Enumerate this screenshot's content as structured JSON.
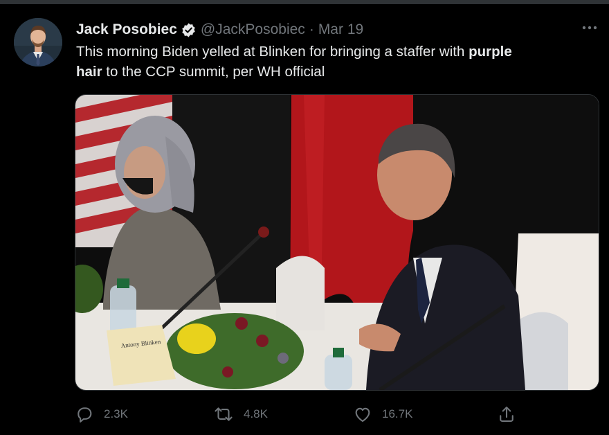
{
  "tweet": {
    "author_name": "Jack Posobiec",
    "author_handle": "@JackPosobiec",
    "separator": "·",
    "date": "Mar 19",
    "text_part1": "This morning Biden yelled at Blinken for bringing a staffer with ",
    "text_bold1": "purple",
    "text_part2": " ",
    "text_bold2": "hair",
    "text_part3": " to the CCP summit, per WH official",
    "media_caption_card": "Antony Blinken"
  },
  "actions": {
    "replies": "2.3K",
    "retweets": "4.8K",
    "likes": "16.7K"
  },
  "icons": {
    "verified": "verified-badge-icon",
    "more": "more-icon",
    "reply": "reply-icon",
    "retweet": "retweet-icon",
    "like": "heart-icon",
    "share": "share-icon"
  },
  "colors": {
    "background": "#000000",
    "text_primary": "#e7e9ea",
    "text_secondary": "#71767b",
    "border": "#2f3336"
  }
}
